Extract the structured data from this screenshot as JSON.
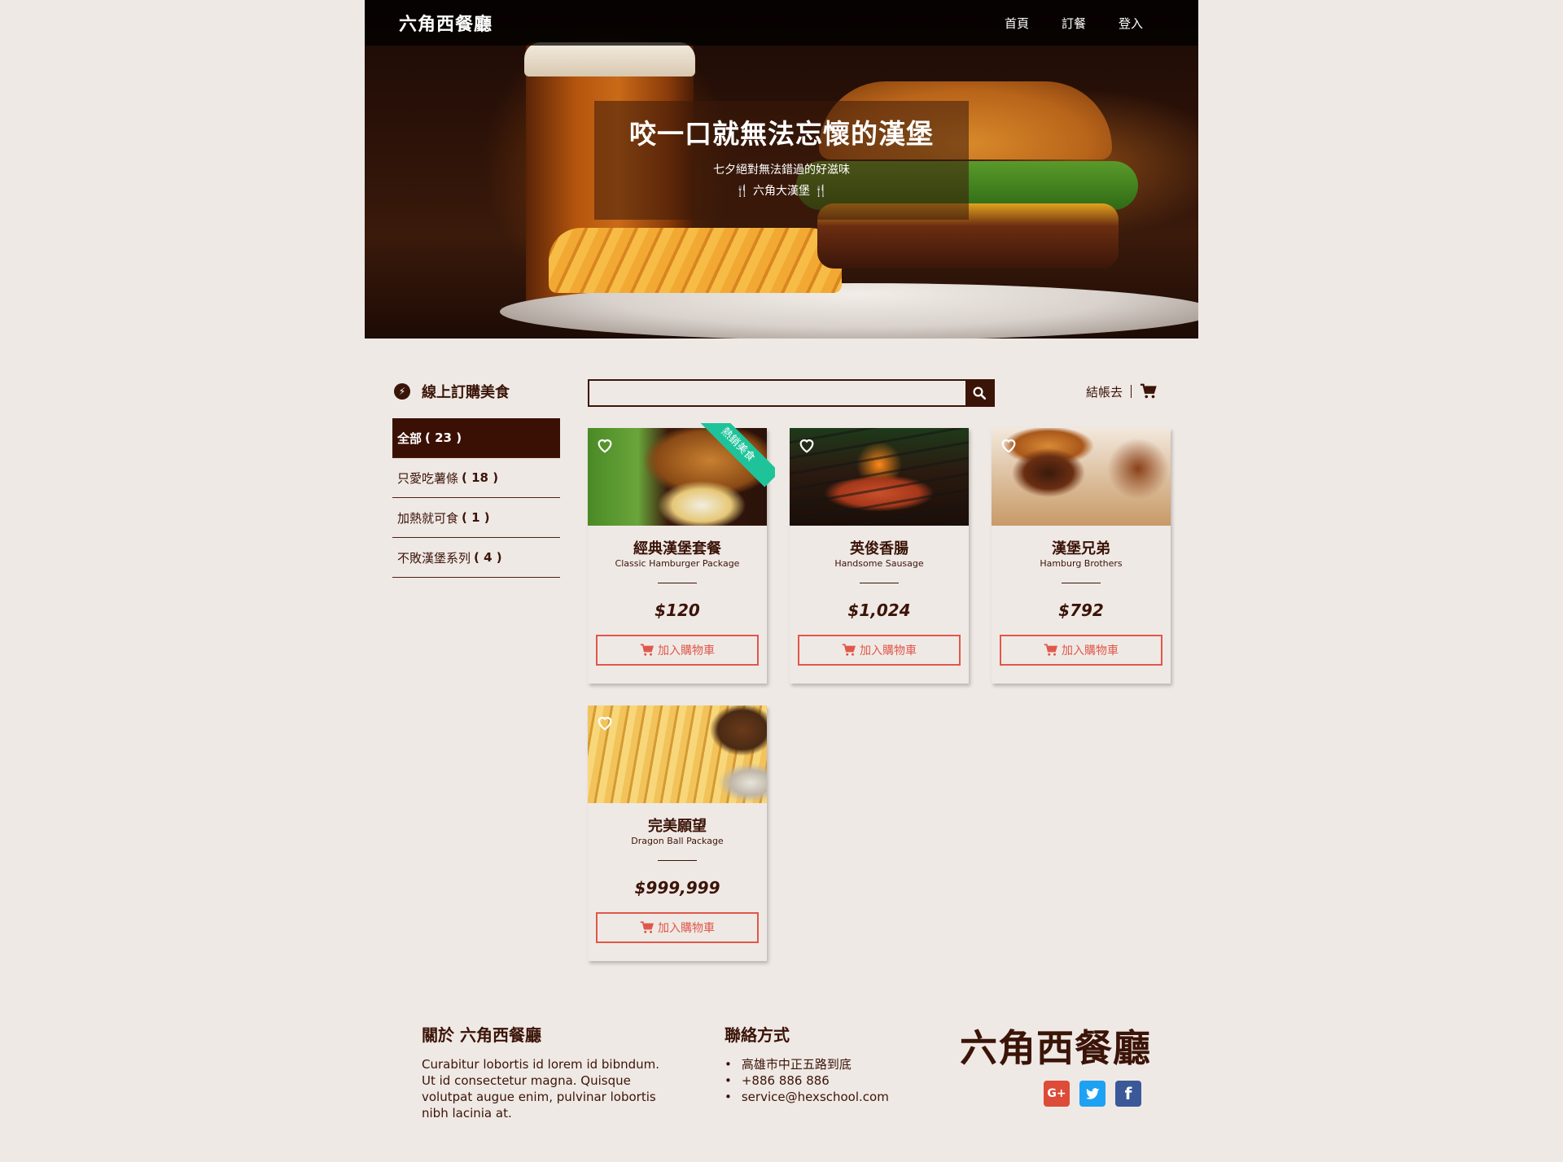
{
  "nav": {
    "brand": "六角西餐廳",
    "links": [
      "首頁",
      "訂餐",
      "登入"
    ]
  },
  "hero": {
    "title": "咬一口就無法忘懷的漢堡",
    "subtitle": "七夕絕對無法錯過的好滋味",
    "tagline": "六角大漢堡"
  },
  "sidebar": {
    "heading": "線上訂購美食",
    "categories": [
      {
        "label": "全部",
        "count": "( 23 )"
      },
      {
        "label": "只愛吃薯條",
        "count": "( 18 )"
      },
      {
        "label": "加熱就可食",
        "count": "( 1 )"
      },
      {
        "label": "不敗漢堡系列",
        "count": "( 4 )"
      }
    ]
  },
  "search": {
    "placeholder": ""
  },
  "toolbar": {
    "checkout_label": "結帳去"
  },
  "products": [
    {
      "name": "經典漢堡套餐",
      "name_en": "Classic Hamburger Package",
      "price": "$120",
      "badge": "熱銷美食",
      "add_label": "加入購物車"
    },
    {
      "name": "英俊香腸",
      "name_en": "Handsome Sausage",
      "price": "$1,024",
      "add_label": "加入購物車"
    },
    {
      "name": "漢堡兄弟",
      "name_en": "Hamburg Brothers",
      "price": "$792",
      "add_label": "加入購物車"
    },
    {
      "name": "完美願望",
      "name_en": "Dragon Ball Package",
      "price": "$999,999",
      "add_label": "加入購物車"
    }
  ],
  "footer": {
    "about_heading": "關於 六角西餐廳",
    "about_text": "Curabitur lobortis id lorem id bibndum. Ut id consectetur magna. Quisque volutpat augue enim, pulvinar lobortis nibh lacinia at.",
    "contact_heading": "聯絡方式",
    "contacts": [
      "高雄市中正五路到底",
      "+886 886 886",
      "service@hexschool.com"
    ],
    "logo": "六角西餐廳",
    "socials": [
      {
        "icon": "google-plus-icon",
        "label": "G+",
        "color": "#dd4b39"
      },
      {
        "icon": "twitter-icon",
        "label": "t",
        "color": "#1da1f2"
      },
      {
        "icon": "facebook-icon",
        "label": "f",
        "color": "#3b5998"
      }
    ]
  },
  "colors": {
    "primary": "#3b1408",
    "accent": "#e0574a",
    "badge": "#1fc39a",
    "background": "#efe9e5"
  }
}
